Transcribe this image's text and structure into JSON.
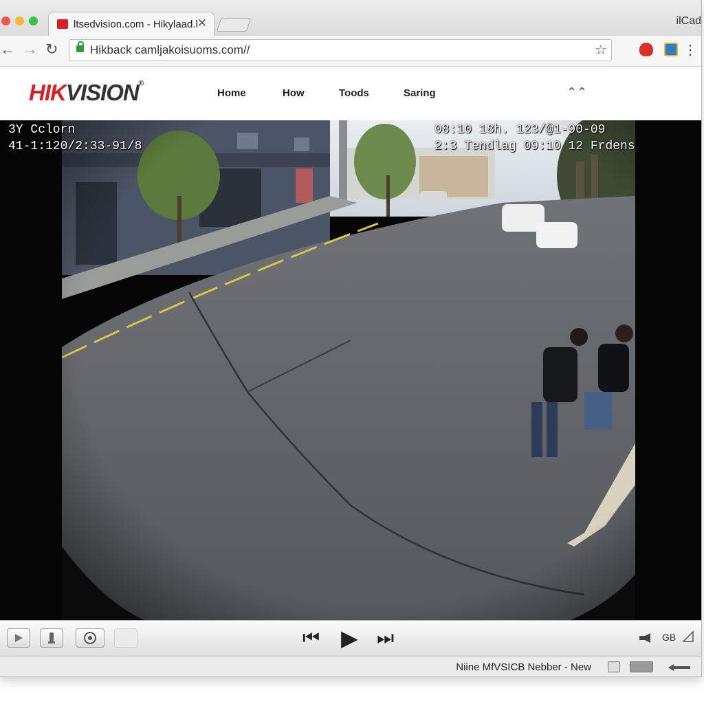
{
  "browser": {
    "tab_title": "ltsedvision.com - Hikylaad.l",
    "tab_close": "✕",
    "profile_label": "ilCad",
    "url": "Hikback camljakoisuoms.com//",
    "back_glyph": "←",
    "forward_glyph": "→",
    "reload_glyph": "↻",
    "bookmark_glyph": "☆",
    "menu_glyph": "⋮"
  },
  "site": {
    "logo_red": "HIK",
    "logo_dark": "VISION",
    "logo_mark": "®",
    "nav": [
      "Home",
      "How",
      "Toods",
      "Saring"
    ],
    "collapse_glyph": "⌃⌃"
  },
  "video": {
    "osd_left_line1": "3Y Cclorn",
    "osd_left_line2": "41-1:120/2:33-91/8",
    "osd_right_line1": "08:10 18h. 123/@1-90-09",
    "osd_right_line2": "2:3 Tendlag 09:10 12 Frdens"
  },
  "player": {
    "prev_glyph": "⏮",
    "play_glyph": "▶",
    "next_glyph": "⏭",
    "quality_label": "GB"
  },
  "statusbar": {
    "text": "Niine MfVSICB Nebber - New"
  },
  "colors": {
    "brand_red": "#d71f26",
    "url_green": "#2f9a3a"
  },
  "icons": [
    "red-favicon",
    "lock-icon",
    "star-icon",
    "fire-extension-icon",
    "tile-extension-icon",
    "menu-icon",
    "play-icon",
    "prev-icon",
    "next-icon",
    "snapshot-icon",
    "record-icon",
    "camera-icon",
    "fullscreen-icon"
  ]
}
